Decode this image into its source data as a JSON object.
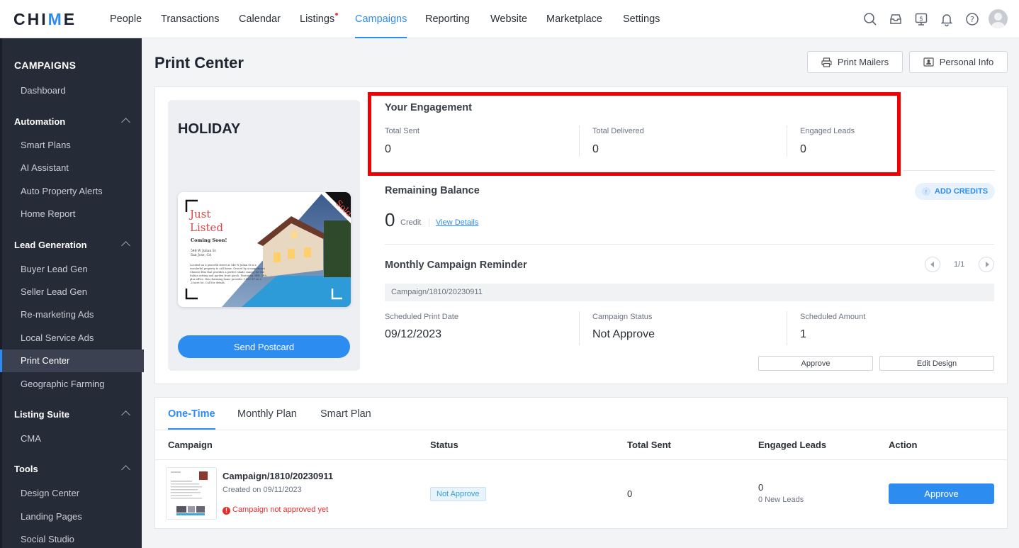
{
  "brand": {
    "logo_text_pre": "CHI",
    "logo_text_accent": "M",
    "logo_text_post": "E",
    "accent_color": "#2d8cf0"
  },
  "nav": {
    "items": [
      {
        "label": "People"
      },
      {
        "label": "Transactions"
      },
      {
        "label": "Calendar"
      },
      {
        "label": "Listings"
      },
      {
        "label": "Campaigns",
        "active": true
      },
      {
        "label": "Reporting"
      },
      {
        "label": "Website"
      },
      {
        "label": "Marketplace"
      },
      {
        "label": "Settings"
      }
    ],
    "icons": [
      "search-icon",
      "inbox-icon",
      "billing-icon",
      "bell-icon",
      "help-icon",
      "avatar"
    ]
  },
  "sidebar": {
    "title": "CAMPAIGNS",
    "dashboard": "Dashboard",
    "sections": [
      {
        "label": "Automation",
        "items": [
          "Smart Plans",
          "AI Assistant",
          "Auto Property Alerts",
          "Home Report"
        ]
      },
      {
        "label": "Lead Generation",
        "items": [
          "Buyer Lead Gen",
          "Seller Lead Gen",
          "Re-marketing Ads",
          "Local Service Ads",
          "Print Center",
          "Geographic Farming"
        ]
      },
      {
        "label": "Listing Suite",
        "items": [
          "CMA"
        ]
      },
      {
        "label": "Tools",
        "items": [
          "Design Center",
          "Landing Pages",
          "Social Studio"
        ]
      }
    ],
    "active_item": "Print Center"
  },
  "page": {
    "title": "Print Center",
    "print_mailers": "Print Mailers",
    "personal_info": "Personal Info"
  },
  "holiday": {
    "title": "HOLIDAY",
    "send_button": "Send Postcard",
    "postcard": {
      "headline_1": "Just",
      "headline_2": "Listed",
      "subhead": "Coming Soon!",
      "address_1": "546 W Julian St",
      "address_2": "San Jose, CA",
      "body": "Located on a peaceful street at 546 W Julian St is a wonderful property to call home. Graced by a magnificent Chinese Elm that provides a perfect shade canopy for the Italian setting and garden front porch. Featuring 3BR, 2BA, plus office, this charming home provides 1,800 SF on a .25acre lot. Call for details.",
      "corner_badge": "Sold"
    }
  },
  "engagement": {
    "title": "Your Engagement",
    "stats": [
      {
        "label": "Total Sent",
        "value": "0"
      },
      {
        "label": "Total Delivered",
        "value": "0"
      },
      {
        "label": "Engaged Leads",
        "value": "0"
      }
    ]
  },
  "balance": {
    "title": "Remaining Balance",
    "value": "0",
    "unit": "Credit",
    "view_details": "View Details",
    "add_credits": "ADD CREDITS"
  },
  "reminder": {
    "title": "Monthly Campaign Reminder",
    "pager": "1/1",
    "campaign_name": "Campaign/1810/20230911",
    "fields": [
      {
        "label": "Scheduled Print Date",
        "value": "09/12/2023"
      },
      {
        "label": "Campaign Status",
        "value": "Not Approve"
      },
      {
        "label": "Scheduled Amount",
        "value": "1"
      }
    ],
    "approve_button": "Approve",
    "edit_button": "Edit Design"
  },
  "table": {
    "tabs": [
      {
        "label": "One-Time",
        "active": true
      },
      {
        "label": "Monthly Plan"
      },
      {
        "label": "Smart Plan"
      }
    ],
    "columns": [
      "Campaign",
      "Status",
      "Total Sent",
      "Engaged Leads",
      "Action"
    ],
    "rows": [
      {
        "name": "Campaign/1810/20230911",
        "created": "Created on 09/11/2023",
        "warning": "Campaign not approved yet",
        "status": "Not Approve",
        "total_sent": "0",
        "engaged_leads": "0",
        "new_leads": "0 New Leads",
        "action": "Approve"
      }
    ]
  }
}
